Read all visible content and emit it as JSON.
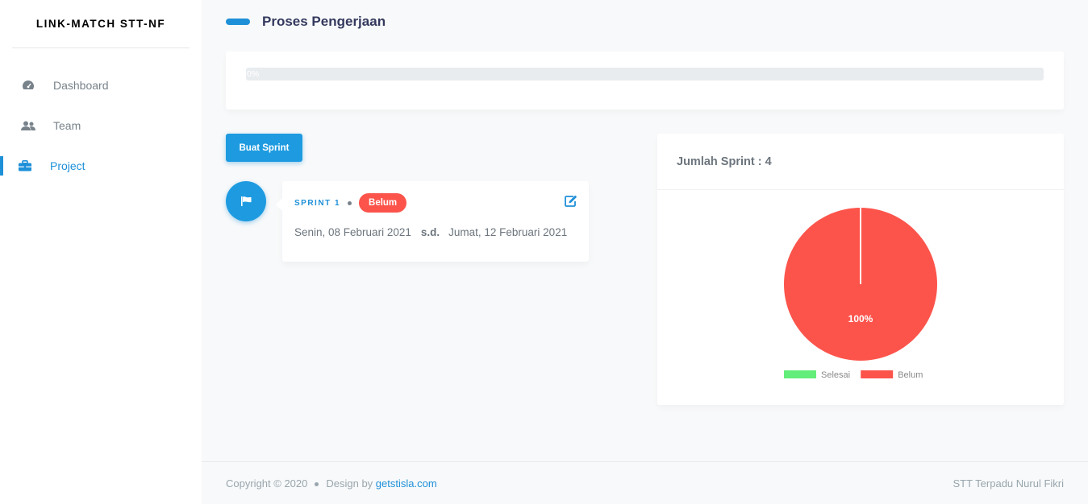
{
  "app": {
    "brand": "LINK-MATCH STT-NF"
  },
  "sidebar": {
    "items": [
      {
        "label": "Dashboard",
        "icon": "dashboard-gauge-icon",
        "active": false
      },
      {
        "label": "Team",
        "icon": "users-icon",
        "active": false
      },
      {
        "label": "Project",
        "icon": "briefcase-icon",
        "active": true
      }
    ]
  },
  "header": {
    "title": "Proses Pengerjaan"
  },
  "progress": {
    "value_percent": 0,
    "label": "0%"
  },
  "actions": {
    "create_sprint_label": "Buat Sprint"
  },
  "sprint": {
    "name": "SPRINT 1",
    "status": "Belum",
    "start_date": "Senin, 08 Februari 2021",
    "separator": "s.d.",
    "end_date": "Jumat, 12 Februari 2021"
  },
  "chart_card": {
    "title": "Jumlah Sprint : 4"
  },
  "chart_data": {
    "type": "pie",
    "categories": [
      "Selesai",
      "Belum"
    ],
    "values": [
      0,
      100
    ],
    "colors": [
      "#63ed7a",
      "#fc544b"
    ],
    "slice_labels": [
      "",
      "100%"
    ],
    "legend": "bottom"
  },
  "footer": {
    "copyright": "Copyright © 2020",
    "design_by": "Design by",
    "design_link": "getstisla.com",
    "right_text": "STT Terpadu Nurul Fikri"
  },
  "colors": {
    "primary": "#1e90d8",
    "danger": "#fc544b",
    "success": "#63ed7a"
  }
}
